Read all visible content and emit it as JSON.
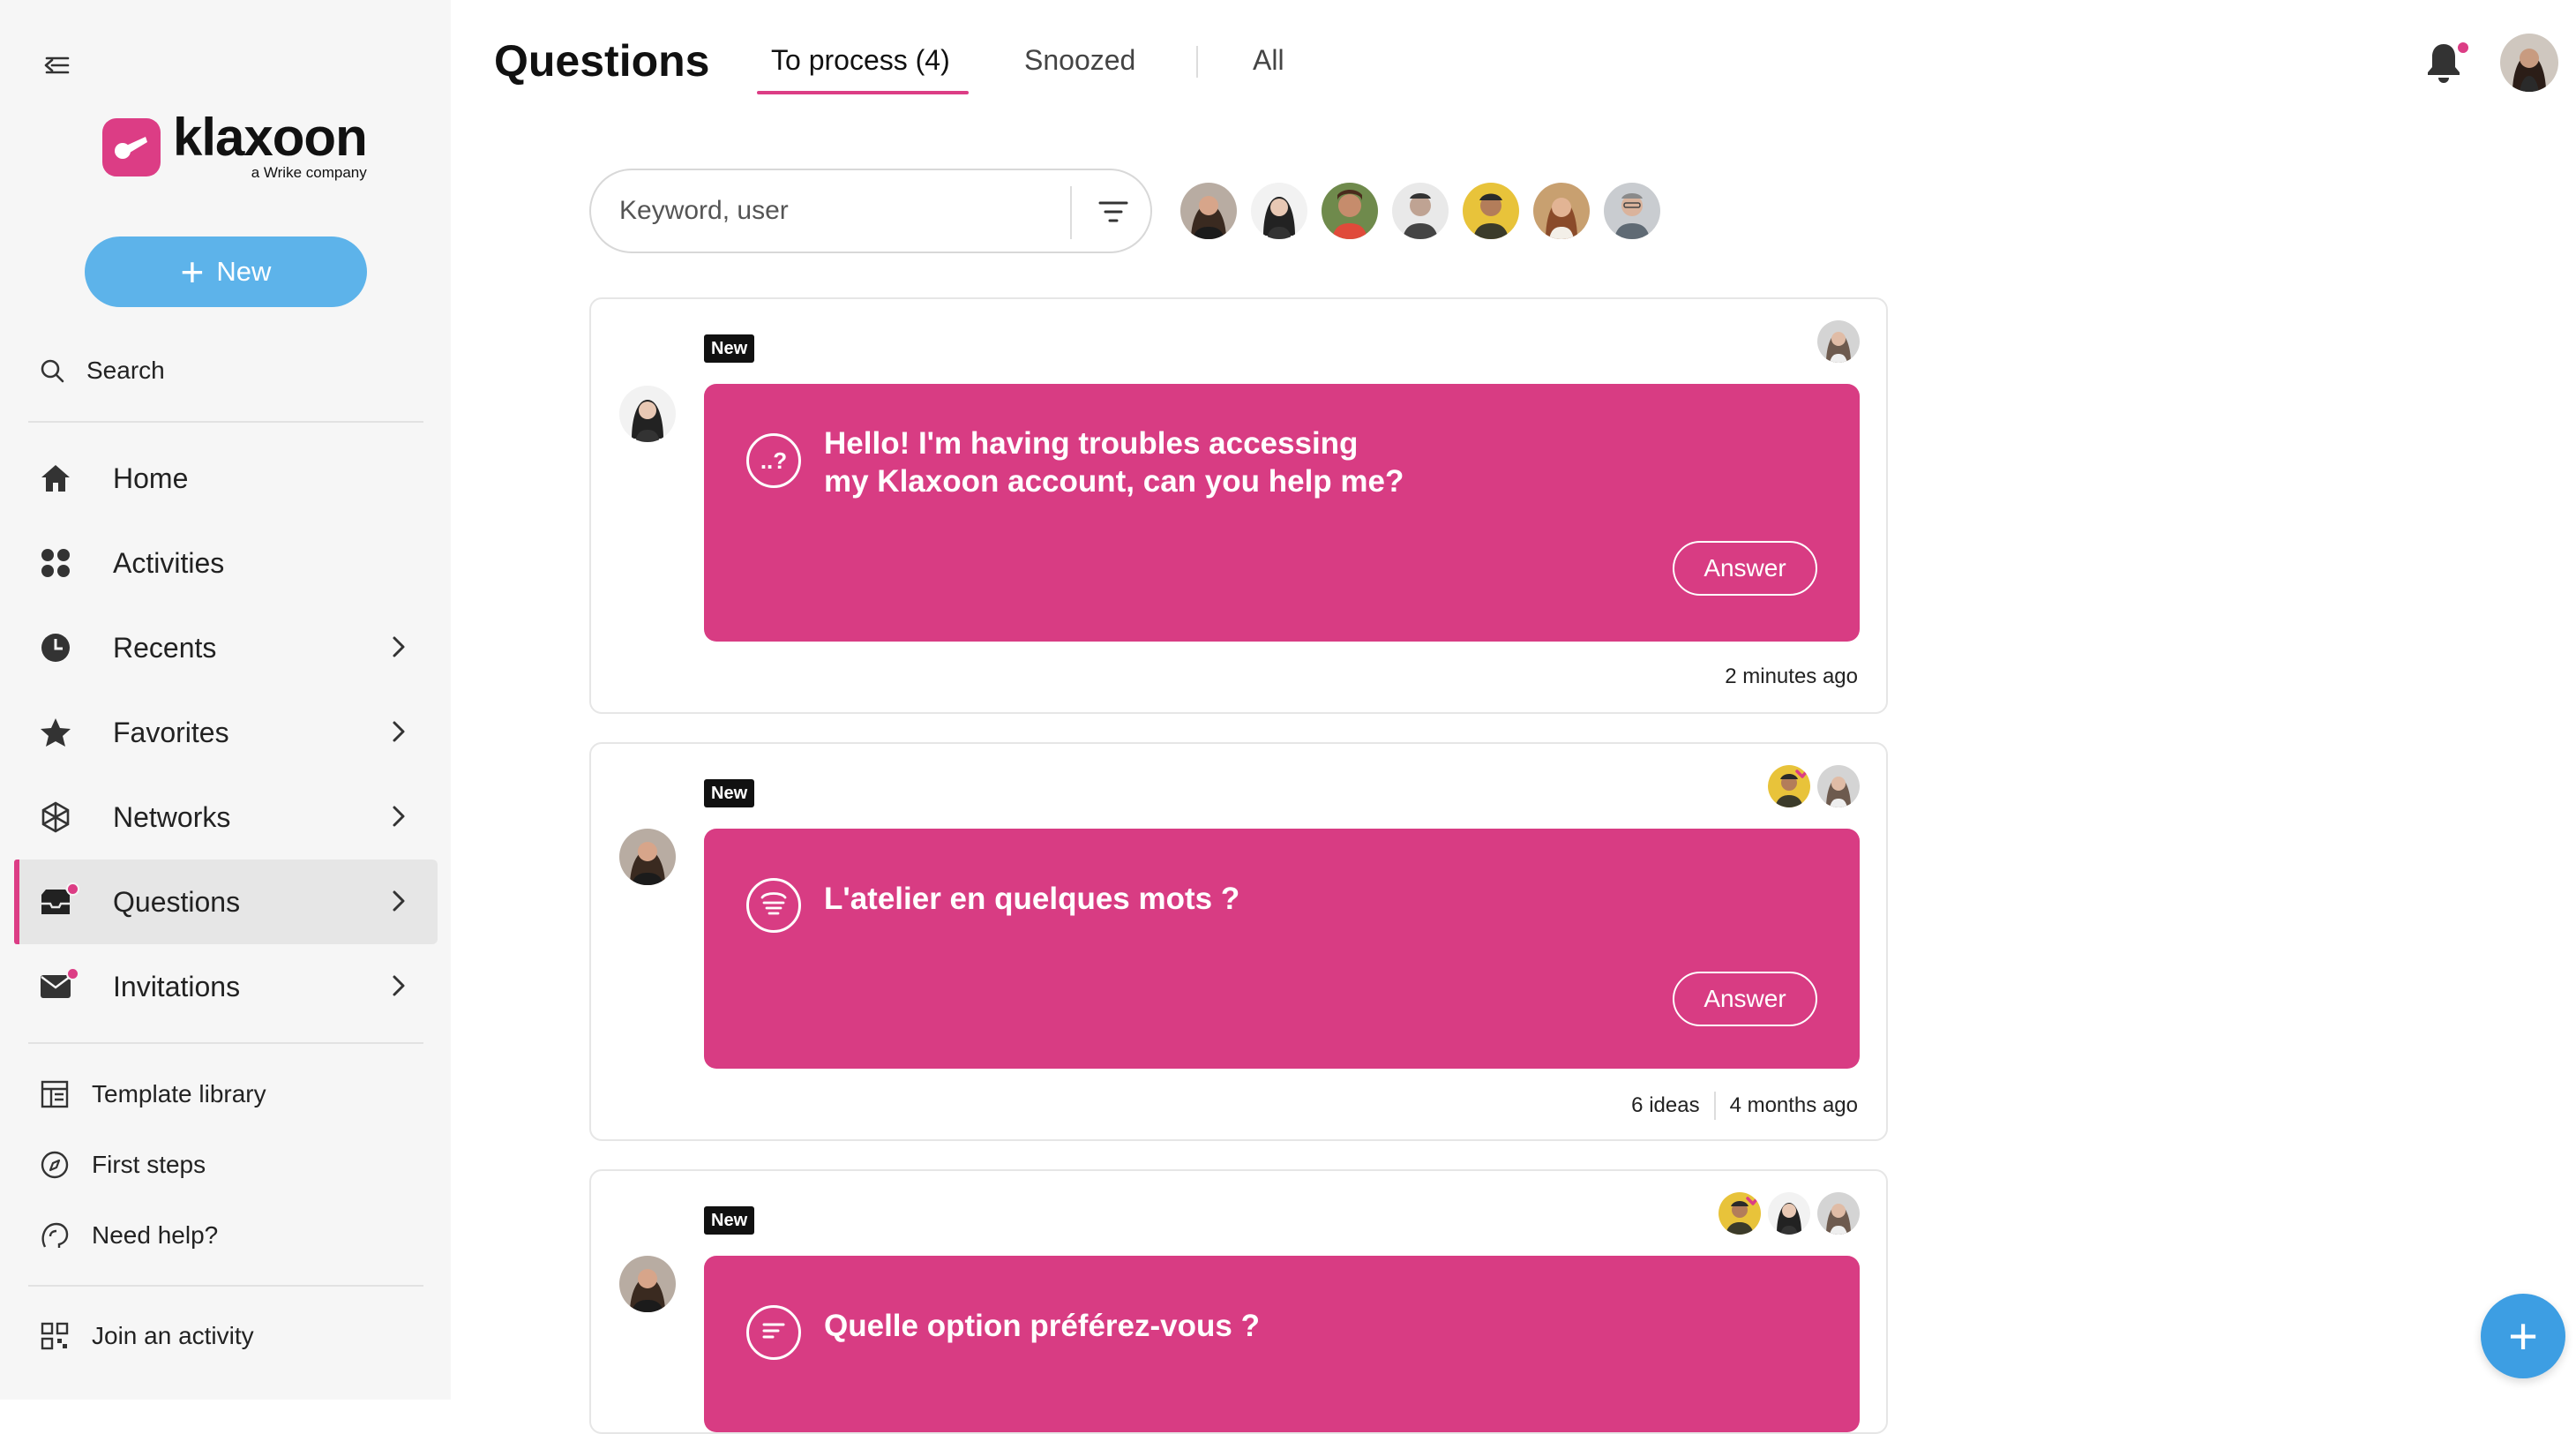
{
  "sidebar": {
    "logo_word": "klaxoon",
    "logo_sub": "a Wrike company",
    "new_label": "New",
    "search_label": "Search",
    "nav": [
      {
        "label": "Home",
        "icon": "home-icon"
      },
      {
        "label": "Activities",
        "icon": "activities-icon"
      },
      {
        "label": "Recents",
        "icon": "clock-icon"
      },
      {
        "label": "Favorites",
        "icon": "star-icon"
      },
      {
        "label": "Networks",
        "icon": "network-icon"
      },
      {
        "label": "Questions",
        "icon": "inbox-icon",
        "active": true
      },
      {
        "label": "Invitations",
        "icon": "mail-icon"
      }
    ],
    "secondary": [
      {
        "label": "Template library",
        "icon": "template-icon"
      },
      {
        "label": "First steps",
        "icon": "compass-icon"
      },
      {
        "label": "Need help?",
        "icon": "help-icon"
      }
    ],
    "join_label": "Join an activity"
  },
  "header": {
    "title": "Questions",
    "tabs": [
      {
        "label": "To process (4)",
        "active": true
      },
      {
        "label": "Snoozed"
      },
      {
        "label": "All"
      }
    ]
  },
  "search": {
    "placeholder": "Keyword, user"
  },
  "cards": [
    {
      "badge": "New",
      "question_line1": "Hello! I'm having troubles accessing",
      "question_line2": "my Klaxoon account, can you help me?",
      "answer_label": "Answer",
      "time": "2 minutes ago",
      "icon": "question-mark-icon"
    },
    {
      "badge": "New",
      "question_line1": "L'atelier en quelques mots ?",
      "question_line2": "",
      "answer_label": "Answer",
      "ideas": "6 ideas",
      "time": "4 months ago",
      "icon": "word-cloud-icon"
    },
    {
      "badge": "New",
      "question_line1": "Quelle option préférez-vous ?",
      "question_line2": "",
      "icon": "poll-icon"
    }
  ],
  "colors": {
    "accent": "#dc3d85",
    "card": "#d83c83",
    "new_button": "#5db3ea",
    "fab": "#3d9ee3"
  }
}
